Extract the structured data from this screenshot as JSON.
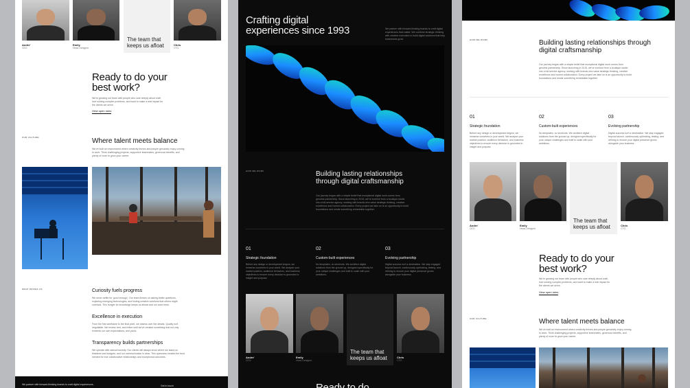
{
  "panel_left": {
    "team": [
      {
        "name": "Andre'",
        "role": "CEO"
      },
      {
        "name": "Emily",
        "role": "Head Designer"
      },
      {
        "name": "Chris",
        "role": "CTO"
      }
    ],
    "quote": "The team that keeps us afloat",
    "cta_title": "Ready to do your best work?",
    "cta_body": "We're growing our team with people who care deeply about craft, love solving complex problems, and want to make a real impact for the clients we serve.",
    "cta_link": "View open roles",
    "culture_tag": "OUR CULTURE",
    "culture_title": "Where talent meets balance",
    "culture_body": "We've built an environment where creativity thrives and people genuinely enjoy coming to work. Think challenging projects, supportive teammates, generous benefits, and plenty of room to grow your career.",
    "values_tag": "WHAT DRIVES US",
    "values": [
      {
        "title": "Curiosity fuels progress",
        "body": "We never settle for 'good enough.' Our team thrives on asking better questions, exploring emerging technologies, and finding creative solutions that others might overlook. This hunger for knowledge keeps us ahead and our work fresh."
      },
      {
        "title": "Excellence in execution",
        "body": "From the first wireframe to the final pixel, we obsess over the details. Quality isn't negotiable. We review, test, and refine until we've created something that not only exceeds our own expectations, and yours."
      },
      {
        "title": "Transparency builds partnerships",
        "body": "We operate with radical honesty. Our clients will always know where we stand on timelines and budgets, and our communication is clear. This openness creates the trust needed for true collaborative relationships and exceptional outcomes."
      }
    ],
    "footer_text": "We partner with forward-thinking brands to craft digital experiences.",
    "footer_link": "Get in touch"
  },
  "panel_middle": {
    "hero_title": "Crafting digital experiences since 1993",
    "hero_body": "We partner with forward-thinking brands to craft digital experiences that matter. We combine strategic thinking with creative execution to build digital solutions that help businesses grow.",
    "about_tag": "HOW WE WORK",
    "about_title": "Building lasting relationships through digital craftsmanship",
    "about_body": "Our journey began with a simple belief that exceptional digital work comes from genuine partnership. Since launching in 2015, we've evolved from a boutique studio into a full-service agency, working with brands who value strategic thinking, creative excellence and honest collaboration. Every project we take on is an opportunity to build foundations and create something remarkable together.",
    "steps": [
      {
        "num": "01",
        "title": "Strategic foundation",
        "body": "Before any design or development begins, we immerse ourselves in your world. We analyze your market position, audience behaviors, and business objectives to ensure every decision is grounded in insight and purpose."
      },
      {
        "num": "02",
        "title": "Custom-built experiences",
        "body": "No templates, no shortcuts. We architect digital solutions from the ground up, designed specifically for your unique challenges and built to scale with your ambitions."
      },
      {
        "num": "03",
        "title": "Evolving partnership",
        "body": "Digital success isn't a destination. We stay engaged beyond launch, continuously optimizing, testing, and refining to ensure your digital presence grows alongside your business."
      }
    ],
    "team": [
      {
        "name": "Andre'",
        "role": "CEO"
      },
      {
        "name": "Emily",
        "role": "Head Designer"
      },
      {
        "name": "Chris",
        "role": "CTO"
      }
    ],
    "quote": "The team that keeps us afloat",
    "cta_partial": "Ready to do"
  },
  "panel_right": {
    "about_tag": "HOW WE WORK",
    "about_title": "Building lasting relationships through digital craftsmanship",
    "about_body": "Our journey began with a simple belief that exceptional digital work comes from genuine partnership. Since launching in 2015, we've evolved from a boutique studio into a full-service agency, working with brands who value strategic thinking, creative excellence and honest collaboration. Every project we take on is an opportunity to build foundations and create something remarkable together.",
    "steps": [
      {
        "num": "01",
        "title": "Strategic foundation",
        "body": "Before any design or development begins, we immerse ourselves in your world. We analyze your market position, audience behaviors, and business objectives to ensure every decision is grounded in insight and purpose."
      },
      {
        "num": "02",
        "title": "Custom-built experiences",
        "body": "No templates, no shortcuts. We architect digital solutions from the ground up, designed specifically for your unique challenges and built to scale with your ambitions."
      },
      {
        "num": "03",
        "title": "Evolving partnership",
        "body": "Digital success isn't a destination. We stay engaged beyond launch, continuously optimizing, testing, and refining to ensure your digital presence grows alongside your business."
      }
    ],
    "team": [
      {
        "name": "Andre'",
        "role": "CEO"
      },
      {
        "name": "Emily",
        "role": "Head Designer"
      },
      {
        "name": "Chris",
        "role": "CTO"
      }
    ],
    "quote": "The team that keeps us afloat",
    "cta_title": "Ready to do your best work?",
    "cta_body": "We're growing our team with people who care deeply about craft, love solving complex problems, and want to make a real impact for the clients we serve.",
    "cta_link": "View open roles",
    "culture_tag": "OUR CULTURE",
    "culture_title": "Where talent meets balance",
    "culture_body": "We've built an environment where creativity thrives and people genuinely enjoy coming to work. Think challenging projects, supportive teammates, generous benefits, and plenty of room to grow your career."
  }
}
